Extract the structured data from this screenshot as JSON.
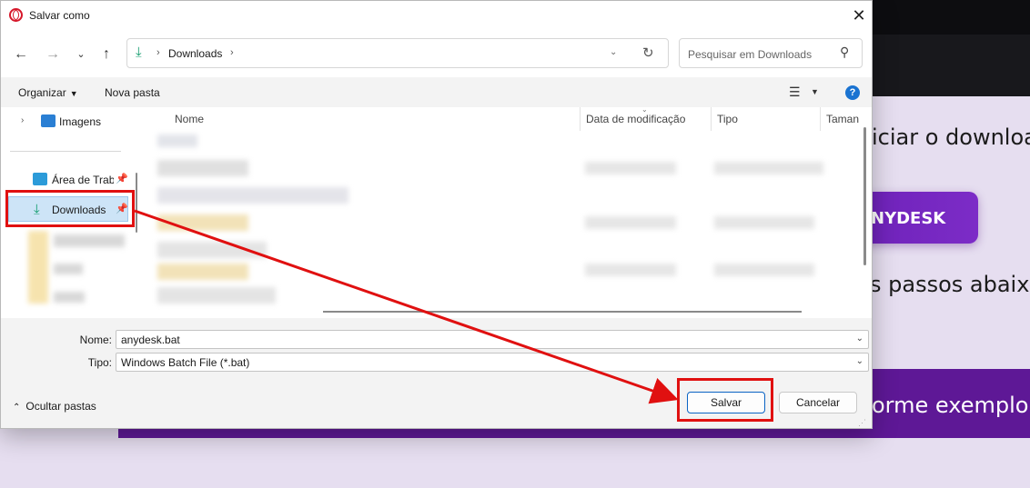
{
  "background_page": {
    "heading_fragment": "iciar o downloa",
    "button_label": "NYDESK",
    "step_fragment": "s passos abaixo",
    "banner_fragment": "orme exemplo a"
  },
  "dialog": {
    "title": "Salvar como",
    "address": {
      "folder": "Downloads"
    },
    "search": {
      "placeholder": "Pesquisar em Downloads"
    },
    "commands": {
      "organize": "Organizar",
      "new_folder": "Nova pasta"
    },
    "nav_pane": {
      "items": [
        {
          "label": "Imagens"
        },
        {
          "label": "Área de Trabalho"
        },
        {
          "label": "Downloads"
        }
      ]
    },
    "columns": [
      "Nome",
      "Data de modificação",
      "Tipo",
      "Taman"
    ],
    "form": {
      "name_label": "Nome:",
      "name_value": "anydesk.bat",
      "type_label": "Tipo:",
      "type_value": "Windows Batch File (*.bat)"
    },
    "footer": {
      "hide_folders": "Ocultar pastas",
      "save": "Salvar",
      "cancel": "Cancelar"
    }
  },
  "colors": {
    "annotation": "#e01010",
    "accent_download": "#139d6e",
    "selection_bg": "#cde4f7",
    "brand_purple": "#6a1fb5"
  }
}
